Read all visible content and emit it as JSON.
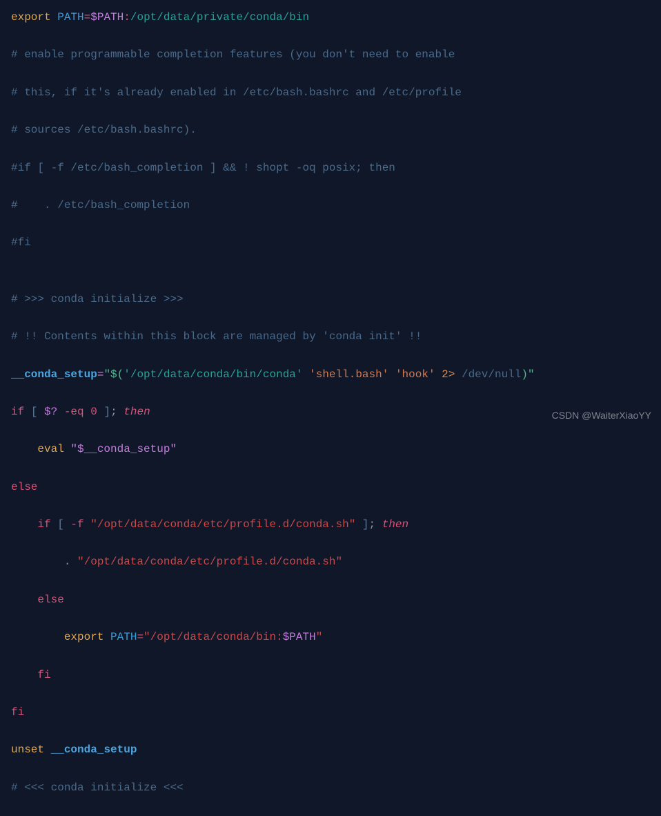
{
  "l1": {
    "export": "export",
    "path": "PATH",
    "eq": "=",
    "pathvar": "$PATH",
    "colon": ":",
    "rest": "/opt/data/private/conda/bin"
  },
  "l2": "# enable programmable completion features (you don't need to enable",
  "l3": "# this, if it's already enabled in /etc/bash.bashrc and /etc/profile",
  "l4": "# sources /etc/bash.bashrc).",
  "l5": "#if [ -f /etc/bash_completion ] && ! shopt -oq posix; then",
  "l6": "#    . /etc/bash_completion",
  "l7": "#fi",
  "l8": "",
  "l9": "# >>> conda initialize >>>",
  "l10": "# !! Contents within this block are managed by 'conda init' !!",
  "l11": {
    "var": "__conda_setup",
    "eq": "=",
    "q1": "\"",
    "cmd_open": "$(",
    "s1": "'/opt/data/conda/bin/conda'",
    "sp1": " ",
    "s2": "'shell.bash'",
    "sp2": " ",
    "s3": "'hook'",
    "sp3": " ",
    "redir": "2",
    "gt": "> ",
    "dev": "/dev/null",
    "close": ")\""
  },
  "l12": {
    "if": "if",
    "sp": " ",
    "lb": "[ ",
    "d": "$?",
    "sp2": " ",
    "flag": "-eq",
    "sp3": " ",
    "num": "0",
    "rb": " ]",
    "semi": ";",
    "sp4": " ",
    "then": "then"
  },
  "l13": {
    "indent": "    ",
    "eval": "eval",
    "sp": " ",
    "str": "\"$__conda_setup\""
  },
  "l14": "else",
  "l15": {
    "indent": "    ",
    "if": "if",
    "sp": " ",
    "lb": "[ ",
    "flag": "-f",
    "sp2": " ",
    "str": "\"/opt/data/conda/etc/profile.d/conda.sh\"",
    "rb": " ]",
    "semi": ";",
    "sp3": " ",
    "then": "then"
  },
  "l16": {
    "indent": "        ",
    "dot": ". ",
    "str": "\"/opt/data/conda/etc/profile.d/conda.sh\""
  },
  "l17": {
    "indent": "    ",
    "else": "else"
  },
  "l18": {
    "indent": "        ",
    "export": "export",
    "sp": " ",
    "var": "PATH",
    "eq": "=",
    "q": "\"",
    "path": "/opt/data/conda/bin:",
    "dvar": "$PATH",
    "q2": "\""
  },
  "l19": {
    "indent": "    ",
    "fi": "fi"
  },
  "l20": "fi",
  "l21": {
    "unset": "unset",
    "sp": " ",
    "var": "__conda_setup"
  },
  "l22": "# <<< conda initialize <<<",
  "watermark": "CSDN @WaiterXiaoYY"
}
